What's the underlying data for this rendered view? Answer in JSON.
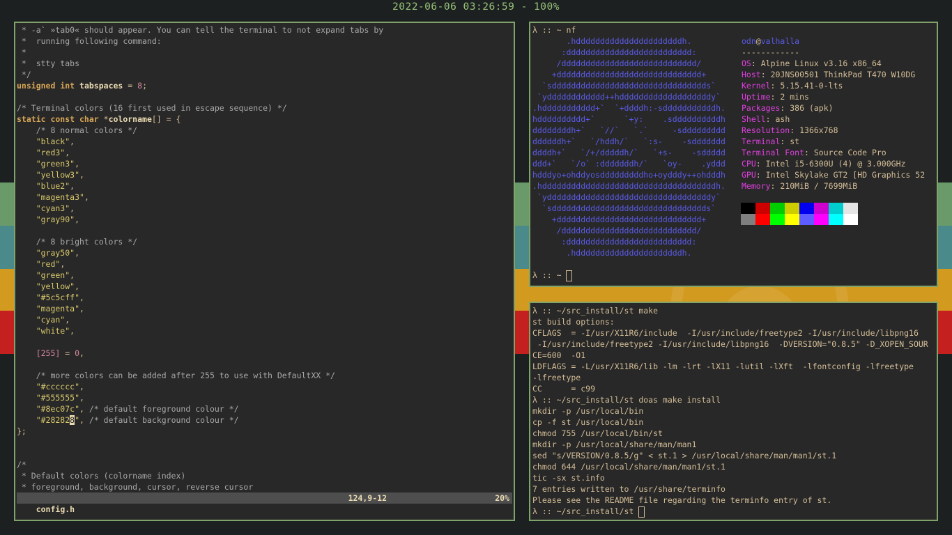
{
  "topbar": {
    "text": "2022-06-06 03:26:59 - 100%"
  },
  "stripes": [
    "#6a9a6a",
    "#4a8a8a",
    "#d39a20",
    "#c42020"
  ],
  "editor": {
    "lines": [
      [
        {
          "c": "cm",
          "t": " * -a` »tab0« should appear. You can tell the terminal to not expand tabs by"
        }
      ],
      [
        {
          "c": "cm",
          "t": " *  running following command:"
        }
      ],
      [
        {
          "c": "cm",
          "t": " *"
        }
      ],
      [
        {
          "c": "cm",
          "t": " *  stty tabs"
        }
      ],
      [
        {
          "c": "cm",
          "t": " */"
        }
      ],
      [
        {
          "c": "kw",
          "t": "unsigned int"
        },
        {
          "c": "plain",
          "t": " "
        },
        {
          "c": "id",
          "t": "tabspaces"
        },
        {
          "c": "plain",
          "t": " = "
        },
        {
          "c": "num",
          "t": "8"
        },
        {
          "c": "plain",
          "t": ";"
        }
      ],
      [
        {
          "c": "plain",
          "t": ""
        }
      ],
      [
        {
          "c": "cm",
          "t": "/* Terminal colors (16 first used in escape sequence) */"
        }
      ],
      [
        {
          "c": "kw",
          "t": "static const char"
        },
        {
          "c": "plain",
          "t": " *"
        },
        {
          "c": "id",
          "t": "colorname"
        },
        {
          "c": "plain",
          "t": "[] = {"
        }
      ],
      [
        {
          "c": "cm",
          "t": "    /* 8 normal colors */"
        }
      ],
      [
        {
          "c": "str",
          "t": "    \"black\""
        },
        {
          "c": "plain",
          "t": ","
        }
      ],
      [
        {
          "c": "str",
          "t": "    \"red3\""
        },
        {
          "c": "plain",
          "t": ","
        }
      ],
      [
        {
          "c": "str",
          "t": "    \"green3\""
        },
        {
          "c": "plain",
          "t": ","
        }
      ],
      [
        {
          "c": "str",
          "t": "    \"yellow3\""
        },
        {
          "c": "plain",
          "t": ","
        }
      ],
      [
        {
          "c": "str",
          "t": "    \"blue2\""
        },
        {
          "c": "plain",
          "t": ","
        }
      ],
      [
        {
          "c": "str",
          "t": "    \"magenta3\""
        },
        {
          "c": "plain",
          "t": ","
        }
      ],
      [
        {
          "c": "str",
          "t": "    \"cyan3\""
        },
        {
          "c": "plain",
          "t": ","
        }
      ],
      [
        {
          "c": "str",
          "t": "    \"gray90\""
        },
        {
          "c": "plain",
          "t": ","
        }
      ],
      [
        {
          "c": "plain",
          "t": ""
        }
      ],
      [
        {
          "c": "cm",
          "t": "    /* 8 bright colors */"
        }
      ],
      [
        {
          "c": "str",
          "t": "    \"gray50\""
        },
        {
          "c": "plain",
          "t": ","
        }
      ],
      [
        {
          "c": "str",
          "t": "    \"red\""
        },
        {
          "c": "plain",
          "t": ","
        }
      ],
      [
        {
          "c": "str",
          "t": "    \"green\""
        },
        {
          "c": "plain",
          "t": ","
        }
      ],
      [
        {
          "c": "str",
          "t": "    \"yellow\""
        },
        {
          "c": "plain",
          "t": ","
        }
      ],
      [
        {
          "c": "str",
          "t": "    \"#5c5cff\""
        },
        {
          "c": "plain",
          "t": ","
        }
      ],
      [
        {
          "c": "str",
          "t": "    \"magenta\""
        },
        {
          "c": "plain",
          "t": ","
        }
      ],
      [
        {
          "c": "str",
          "t": "    \"cyan\""
        },
        {
          "c": "plain",
          "t": ","
        }
      ],
      [
        {
          "c": "str",
          "t": "    \"white\""
        },
        {
          "c": "plain",
          "t": ","
        }
      ],
      [
        {
          "c": "plain",
          "t": ""
        }
      ],
      [
        {
          "c": "plain",
          "t": "    "
        },
        {
          "c": "num",
          "t": "[255]"
        },
        {
          "c": "plain",
          "t": " = "
        },
        {
          "c": "num",
          "t": "0"
        },
        {
          "c": "plain",
          "t": ","
        }
      ],
      [
        {
          "c": "plain",
          "t": ""
        }
      ],
      [
        {
          "c": "cm",
          "t": "    /* more colors can be added after 255 to use with DefaultXX */"
        }
      ],
      [
        {
          "c": "str",
          "t": "    \"#cccccc\""
        },
        {
          "c": "plain",
          "t": ","
        }
      ],
      [
        {
          "c": "str",
          "t": "    \"#555555\""
        },
        {
          "c": "plain",
          "t": ","
        }
      ],
      [
        {
          "c": "str",
          "t": "    \"#8ec07c\""
        },
        {
          "c": "plain",
          "t": ", "
        },
        {
          "c": "cm",
          "t": "/* default foreground colour */"
        }
      ],
      [
        {
          "c": "str",
          "t": "    \"#28282"
        },
        {
          "c": "cursor-char",
          "t": "8"
        },
        {
          "c": "str",
          "t": "\""
        },
        {
          "c": "plain",
          "t": ", "
        },
        {
          "c": "cm",
          "t": "/* default background colour */"
        }
      ],
      [
        {
          "c": "plain",
          "t": "};"
        }
      ],
      [
        {
          "c": "plain",
          "t": ""
        }
      ],
      [
        {
          "c": "plain",
          "t": ""
        }
      ],
      [
        {
          "c": "cm",
          "t": "/*"
        }
      ],
      [
        {
          "c": "cm",
          "t": " * Default colors (colorname index)"
        }
      ],
      [
        {
          "c": "cm",
          "t": " * foreground, background, cursor, reverse cursor"
        }
      ]
    ],
    "status": {
      "filename": "config.h",
      "position": "124,9-12",
      "percent": "20%"
    }
  },
  "neofetch": {
    "prompt": "λ :: ~ nf",
    "ascii": [
      "       .hddddddddddddddddddddddh.",
      "      :dddddddddddddddddddddddddd:",
      "     /dddddddddddddddddddddddddddd/",
      "    +dddddddddddddddddddddddddddddd+",
      "  `sdddddddddddddddddddddddddddddddds`",
      " `ydddddddddddd++hdddddddddddddddddddy`",
      ".hddddddddddd+`  `+ddddh:-sdddddddddddh.",
      "hdddddddddd+`      `+y:    .sddddddddddh",
      "ddddddddh+`   `//`   `.`     -sddddddddd",
      "ddddddh+`   `/hddh/`   `:s-    -sddddddd",
      "ddddh+`   `/+/dddddh/`   `+s-    -sddddd",
      "ddd+`   `/o` :dddddddh/`   `oy-    .yddd",
      "hdddyo+ohddyosdddddddddho+oydddy++ohdddh",
      ".hddddddddddddddddddddddddddddddddddddh.",
      " `yddddddddddddddddddddddddddddddddddy`",
      "  `sdddddddddddddddddddddddddddddddds`",
      "    +dddddddddddddddddddddddddddddd+",
      "     /dddddddddddddddddddddddddddd/",
      "      :dddddddddddddddddddddddddd:",
      "       .hddddddddddddddddddddddh."
    ],
    "user": "odn",
    "host": "valhalla",
    "separator": "------------",
    "info": [
      {
        "label": "OS",
        "value": "Alpine Linux v3.16 x86_64"
      },
      {
        "label": "Host",
        "value": "20JNS00501 ThinkPad T470 W10DG"
      },
      {
        "label": "Kernel",
        "value": "5.15.41-0-lts"
      },
      {
        "label": "Uptime",
        "value": "2 mins"
      },
      {
        "label": "Packages",
        "value": "386 (apk)"
      },
      {
        "label": "Shell",
        "value": "ash"
      },
      {
        "label": "Resolution",
        "value": "1366x768"
      },
      {
        "label": "Terminal",
        "value": "st"
      },
      {
        "label": "Terminal Font",
        "value": "Source Code Pro"
      },
      {
        "label": "CPU",
        "value": "Intel i5-6300U (4) @ 3.000GHz"
      },
      {
        "label": "GPU",
        "value": "Intel Skylake GT2 [HD Graphics 52"
      },
      {
        "label": "Memory",
        "value": "210MiB / 7699MiB"
      }
    ],
    "palette_normal": [
      "#000000",
      "#cd0000",
      "#00cd00",
      "#cdcd00",
      "#0000ee",
      "#cd00cd",
      "#00cdcd",
      "#e5e5e5"
    ],
    "palette_bright": [
      "#7f7f7f",
      "#ff0000",
      "#00ff00",
      "#ffff00",
      "#5c5cff",
      "#ff00ff",
      "#00ffff",
      "#ffffff"
    ],
    "end_prompt": "λ :: ~ "
  },
  "build_term": {
    "lines": [
      "λ :: ~/src_install/st make",
      "st build options:",
      "CFLAGS  = -I/usr/X11R6/include  -I/usr/include/freetype2 -I/usr/include/libpng16",
      " -I/usr/include/freetype2 -I/usr/include/libpng16  -DVERSION=\"0.8.5\" -D_XOPEN_SOUR",
      "CE=600  -O1",
      "LDFLAGS = -L/usr/X11R6/lib -lm -lrt -lX11 -lutil -lXft  -lfontconfig -lfreetype",
      "-lfreetype",
      "CC      = c99",
      "λ :: ~/src_install/st doas make install",
      "mkdir -p /usr/local/bin",
      "cp -f st /usr/local/bin",
      "chmod 755 /usr/local/bin/st",
      "mkdir -p /usr/local/share/man/man1",
      "sed \"s/VERSION/0.8.5/g\" < st.1 > /usr/local/share/man/man1/st.1",
      "chmod 644 /usr/local/share/man/man1/st.1",
      "tic -sx st.info",
      "7 entries written to /usr/share/terminfo",
      "Please see the README file regarding the terminfo entry of st."
    ],
    "end_prompt": "λ :: ~/src_install/st "
  }
}
